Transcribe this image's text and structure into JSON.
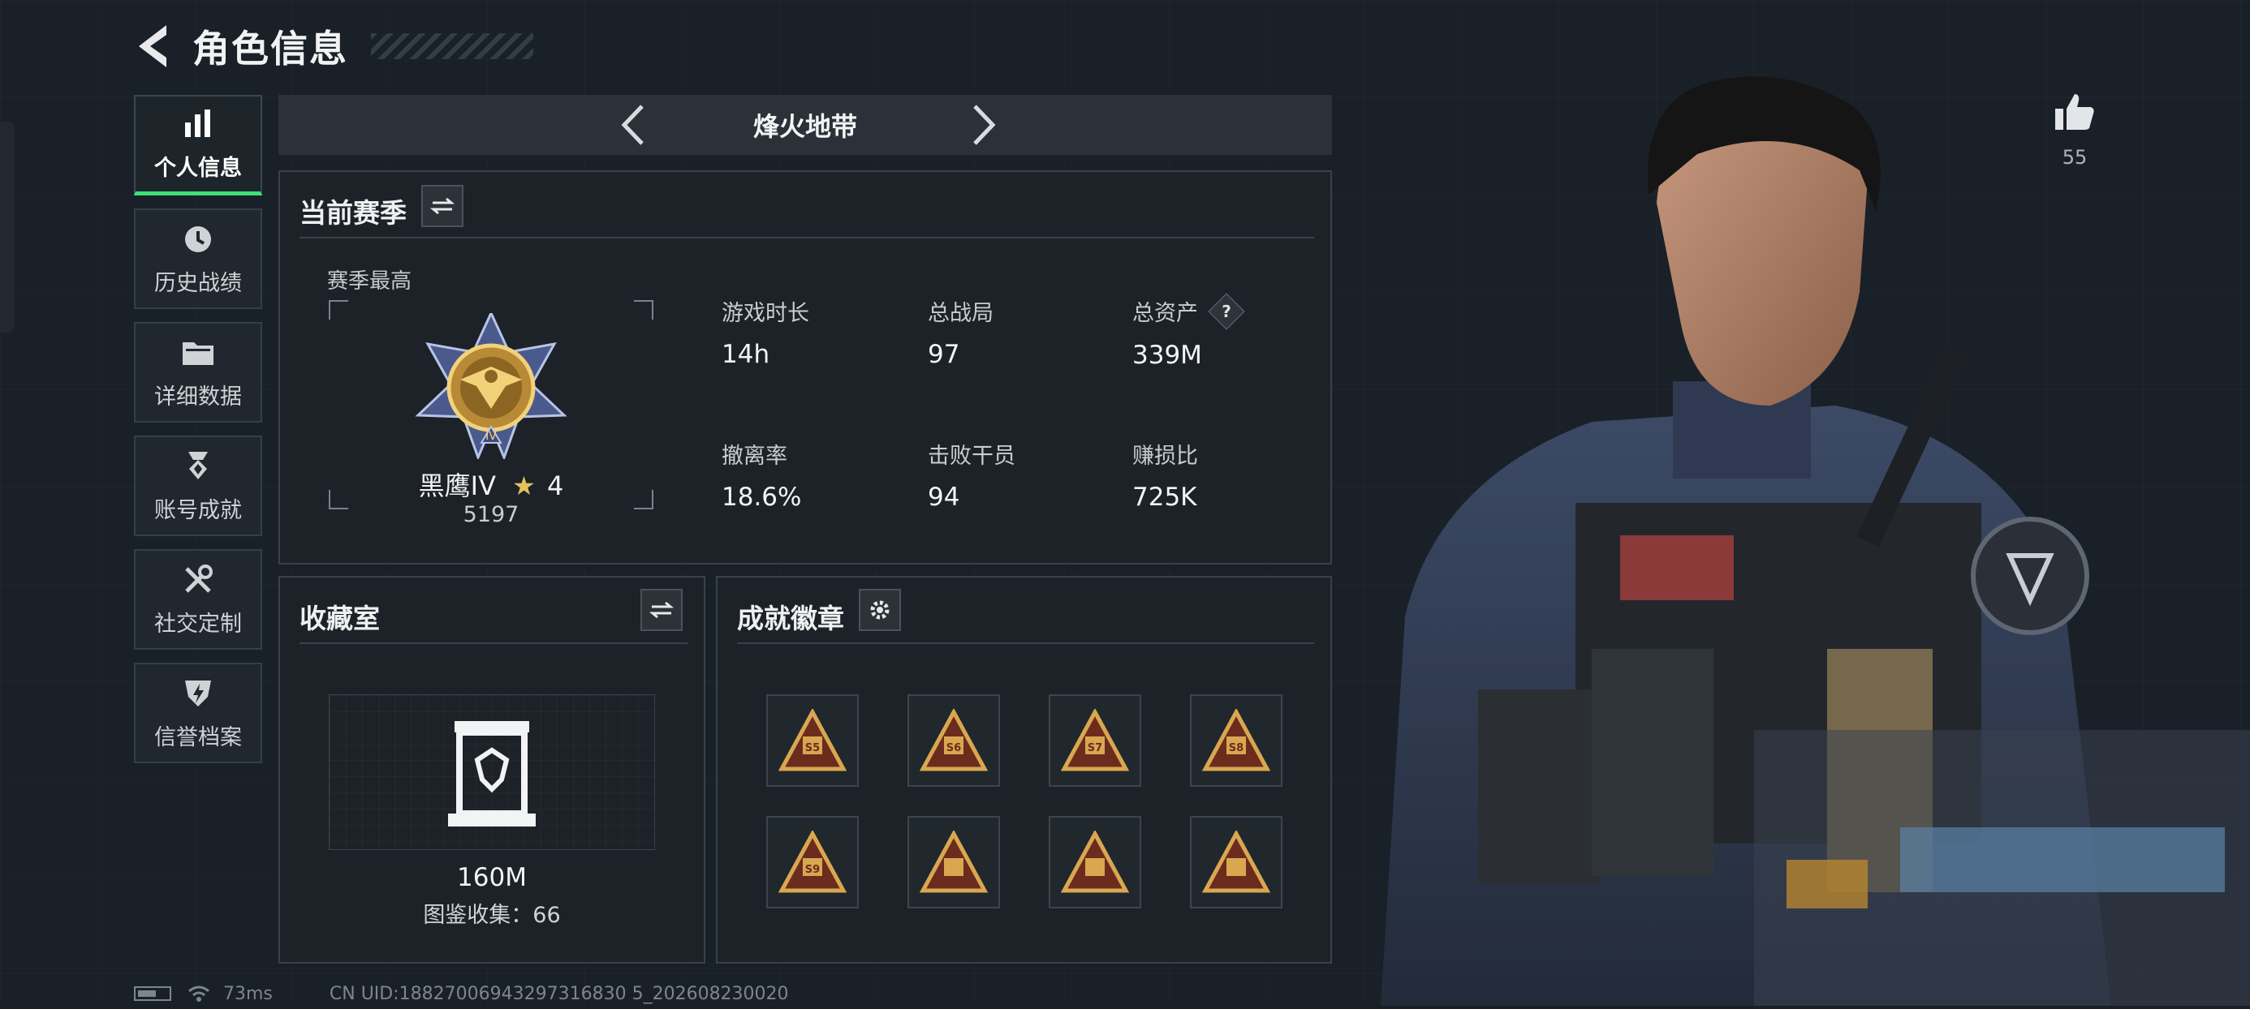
{
  "header": {
    "title": "角色信息"
  },
  "sidebar": {
    "items": [
      {
        "label": "个人信息",
        "icon": "bar-chart-icon",
        "active": true
      },
      {
        "label": "历史战绩",
        "icon": "clock-icon",
        "active": false
      },
      {
        "label": "详细数据",
        "icon": "folder-icon",
        "active": false
      },
      {
        "label": "账号成就",
        "icon": "medal-icon",
        "active": false
      },
      {
        "label": "社交定制",
        "icon": "tools-icon",
        "active": false
      },
      {
        "label": "信誉档案",
        "icon": "shield-icon",
        "active": false
      }
    ]
  },
  "mode": {
    "title": "烽火地带"
  },
  "season": {
    "title": "当前赛季",
    "best_label": "赛季最高",
    "rank_name": "黑鹰IV",
    "rank_stars": "4",
    "rank_score": "5197",
    "stats": [
      {
        "label": "游戏时长",
        "value": "14h"
      },
      {
        "label": "总战局",
        "value": "97"
      },
      {
        "label": "总资产",
        "value": "339M",
        "help": "?"
      },
      {
        "label": "撤离率",
        "value": "18.6%"
      },
      {
        "label": "击败干员",
        "value": "94"
      },
      {
        "label": "赚损比",
        "value": "725K"
      }
    ]
  },
  "collection": {
    "title": "收藏室",
    "value": "160M",
    "count_text": "图鉴收集：66"
  },
  "achievements": {
    "title": "成就徽章",
    "badges": [
      "S5",
      "S6",
      "S7",
      "S8",
      "S9",
      "",
      "",
      ""
    ]
  },
  "social": {
    "likes": "55"
  },
  "status": {
    "ping": "73ms",
    "uid": "CN UID:18827006943297316830 5_202608230020"
  },
  "colors": {
    "accent_green": "#3fe07a",
    "gold": "#c9a04a",
    "panel_bg": "#1c2228"
  }
}
